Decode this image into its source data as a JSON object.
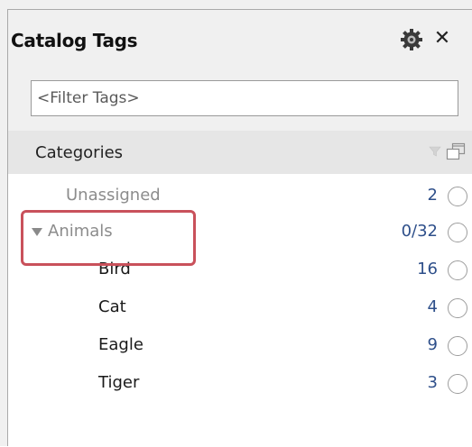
{
  "panel": {
    "title": "Catalog Tags",
    "icons": {
      "settings": "gear-icon",
      "close": "close-icon",
      "close_glyph": "✕"
    }
  },
  "filter": {
    "placeholder": "<Filter Tags>",
    "value": ""
  },
  "categories": {
    "header_label": "Categories",
    "items": [
      {
        "label": "Unassigned",
        "count": "2",
        "level": 0,
        "muted": true
      },
      {
        "label": "Animals",
        "count": "0/32",
        "level": 0,
        "muted": true,
        "expanded": true
      },
      {
        "label": "Bird",
        "count": "16",
        "level": 1
      },
      {
        "label": "Cat",
        "count": "4",
        "level": 1
      },
      {
        "label": "Eagle",
        "count": "9",
        "level": 1
      },
      {
        "label": "Tiger",
        "count": "3",
        "level": 1
      }
    ]
  },
  "colors": {
    "count_text": "#2e4f8a",
    "highlight_border": "#c9515b",
    "header_bg": "#e6e6e6"
  }
}
